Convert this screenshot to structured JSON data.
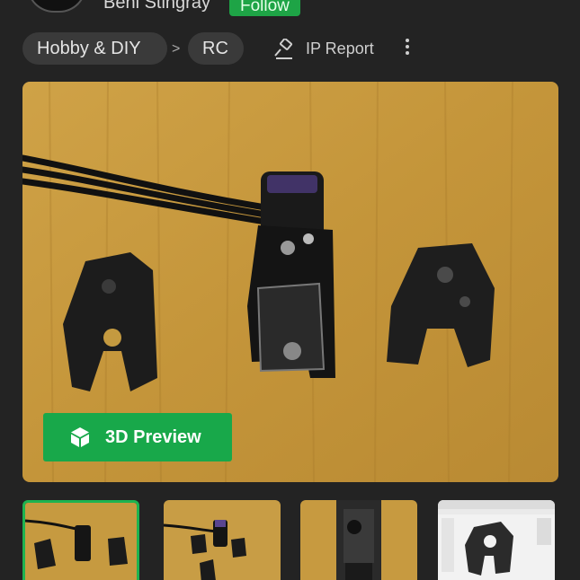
{
  "header": {
    "author_name": "Beni Stingray",
    "follow_label": "Follow"
  },
  "breadcrumb": {
    "category": "Hobby & DIY",
    "separator": ">",
    "subcategory": "RC"
  },
  "actions": {
    "ip_report_label": "IP Report"
  },
  "preview": {
    "button_label": "3D Preview",
    "button_color": "#18a84a"
  },
  "thumbnails": [
    {
      "name": "thumbnail-1",
      "active": true
    },
    {
      "name": "thumbnail-2",
      "active": false
    },
    {
      "name": "thumbnail-3",
      "active": false
    },
    {
      "name": "thumbnail-4",
      "active": false
    }
  ],
  "colors": {
    "background": "#232323",
    "chip": "#3a3a3a",
    "accent": "#1ea446",
    "wood": "#c79a3e"
  }
}
